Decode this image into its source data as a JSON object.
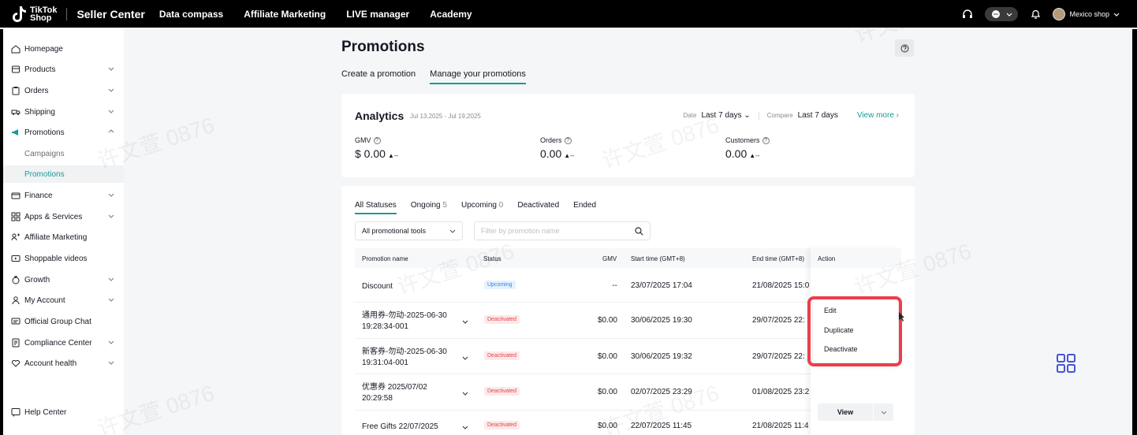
{
  "topbar": {
    "logo_line1": "TikTok",
    "logo_line2": "Shop",
    "app_name": "Seller Center",
    "nav": [
      "Data compass",
      "Affiliate Marketing",
      "LIVE manager",
      "Academy"
    ],
    "shop_name": "Mexico shop"
  },
  "sidebar": {
    "items": [
      {
        "label": "Homepage",
        "icon": "home-icon",
        "chevron": false
      },
      {
        "label": "Products",
        "icon": "box-icon",
        "chevron": true
      },
      {
        "label": "Orders",
        "icon": "clipboard-icon",
        "chevron": true
      },
      {
        "label": "Shipping",
        "icon": "truck-icon",
        "chevron": true
      },
      {
        "label": "Promotions",
        "icon": "megaphone-icon",
        "chevron": true,
        "expanded": true
      },
      {
        "label": "Campaigns",
        "sub": true
      },
      {
        "label": "Promotions",
        "sub": true,
        "active": true
      },
      {
        "label": "Finance",
        "icon": "wallet-icon",
        "chevron": true
      },
      {
        "label": "Apps & Services",
        "icon": "apps-icon",
        "chevron": true
      },
      {
        "label": "Affiliate Marketing",
        "icon": "people-icon",
        "chevron": false
      },
      {
        "label": "Shoppable videos",
        "icon": "video-icon",
        "chevron": false
      },
      {
        "label": "Growth",
        "icon": "growth-icon",
        "chevron": true
      },
      {
        "label": "My Account",
        "icon": "user-icon",
        "chevron": true
      },
      {
        "label": "Official Group Chat",
        "icon": "chat-icon",
        "chevron": false
      },
      {
        "label": "Compliance Center",
        "icon": "document-icon",
        "chevron": true
      },
      {
        "label": "Account health",
        "icon": "heart-icon",
        "chevron": true
      }
    ],
    "help_center": "Help Center"
  },
  "page": {
    "title": "Promotions",
    "tabs": [
      "Create a promotion",
      "Manage your promotions"
    ]
  },
  "analytics": {
    "title": "Analytics",
    "range": "Jul 13,2025 - Jul 19,2025",
    "date_label": "Date",
    "date_value": "Last 7 days",
    "compare_label": "Compare",
    "compare_value": "Last 7 days",
    "view_more": "View more",
    "metrics": [
      {
        "label": "GMV",
        "value": "$ 0.00",
        "change": "--"
      },
      {
        "label": "Orders",
        "value": "0.00",
        "change": "--"
      },
      {
        "label": "Customers",
        "value": "0.00",
        "change": "--"
      }
    ]
  },
  "list": {
    "status_tabs": [
      {
        "label": "All Statuses",
        "count": ""
      },
      {
        "label": "Ongoing",
        "count": "5"
      },
      {
        "label": "Upcoming",
        "count": "0"
      },
      {
        "label": "Deactivated",
        "count": ""
      },
      {
        "label": "Ended",
        "count": ""
      }
    ],
    "tool_filter": "All promotional tools",
    "search_placeholder": "Filter by promotion name",
    "columns": [
      "Promotion name",
      "Status",
      "GMV",
      "Start time (GMT+8)",
      "End time (GMT+8)",
      "Action"
    ],
    "rows": [
      {
        "name1": "Discount",
        "name2": "",
        "status": "Upcoming",
        "gmv": "--",
        "start": "23/07/2025 17:04",
        "end": "21/08/2025 15:0"
      },
      {
        "name1": "通用券-勿动-2025-06-30",
        "name2": "19:28:34-001",
        "status": "Deactivated",
        "gmv": "$0.00",
        "start": "30/06/2025 19:30",
        "end": "29/07/2025 22:"
      },
      {
        "name1": "新客券-勿动-2025-06-30",
        "name2": "19:31:04-001",
        "status": "Deactivated",
        "gmv": "$0.00",
        "start": "30/06/2025 19:32",
        "end": "29/07/2025 22:"
      },
      {
        "name1": "优惠券 2025/07/02",
        "name2": "20:29:58",
        "status": "Deactivated",
        "gmv": "$0.00",
        "start": "02/07/2025 23:29",
        "end": "01/08/2025 23:2"
      },
      {
        "name1": "Free Gifts 22/07/2025",
        "name2": "",
        "status": "Deactivated",
        "gmv": "$0.00",
        "start": "22/07/2025 11:45",
        "end": "21/08/2025 11:4"
      }
    ],
    "view_label": "View"
  },
  "dropdown": {
    "items": [
      "Edit",
      "Duplicate",
      "Deactivate"
    ]
  },
  "watermark_text": "许文萱 0876",
  "colors": {
    "accent": "#179c9a",
    "highlight": "#ec3e4b",
    "deactivated": "#e8414b",
    "upcoming": "#2d7ff9"
  }
}
